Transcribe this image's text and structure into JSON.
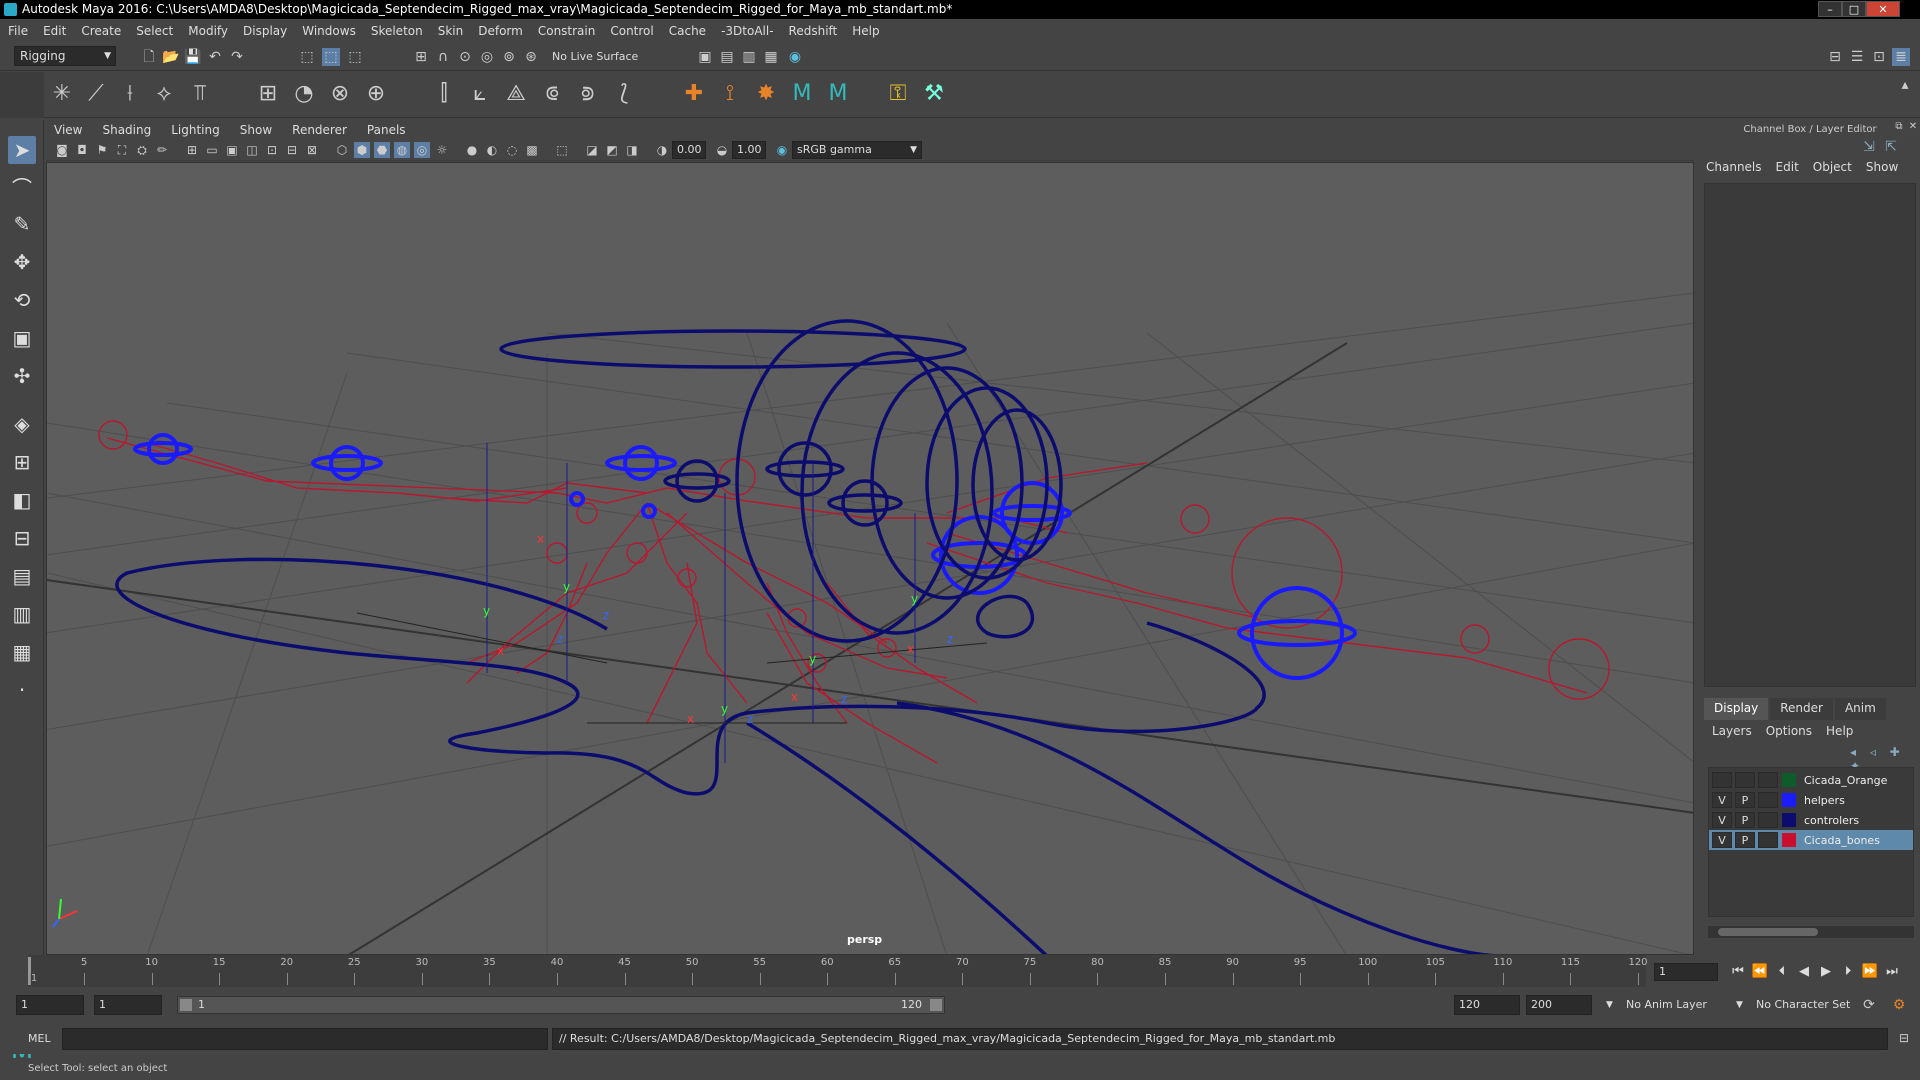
{
  "window": {
    "title": "Autodesk Maya 2016: C:\\Users\\AMDA8\\Desktop\\Magicicada_Septendecim_Rigged_max_vray\\Magicicada_Septendecim_Rigged_for_Maya_mb_standart.mb*",
    "controls": {
      "minimize": "–",
      "maximize": "□",
      "close": "✕"
    }
  },
  "menubar": {
    "items": [
      "File",
      "Edit",
      "Create",
      "Select",
      "Modify",
      "Display",
      "Windows",
      "Skeleton",
      "Skin",
      "Deform",
      "Constrain",
      "Control",
      "Cache",
      "-3DtoAll-",
      "Redshift",
      "Help"
    ]
  },
  "statusline": {
    "mode": "Rigging",
    "live_surface": "No Live Surface"
  },
  "viewport": {
    "menus": [
      "View",
      "Shading",
      "Lighting",
      "Show",
      "Renderer",
      "Panels"
    ],
    "exposure": "0.00",
    "gamma": "1.00",
    "color_space": "sRGB gamma",
    "camera_label": "persp",
    "axis_colors": {
      "x": "#ff3333",
      "y": "#33ff33",
      "z": "#3366ff"
    }
  },
  "channel_box": {
    "title": "Channel Box / Layer Editor",
    "menus": [
      "Channels",
      "Edit",
      "Object",
      "Show"
    ]
  },
  "layer_editor": {
    "tabs": [
      "Display",
      "Render",
      "Anim"
    ],
    "active_tab": "Display",
    "menus": [
      "Layers",
      "Options",
      "Help"
    ],
    "layers": [
      {
        "v": "",
        "p": "",
        "color": "#0e5c2a",
        "name": "Cicada_Orange"
      },
      {
        "v": "V",
        "p": "P",
        "color": "#1c1cff",
        "name": "helpers"
      },
      {
        "v": "V",
        "p": "P",
        "color": "#0c0c6e",
        "name": "controlers"
      },
      {
        "v": "V",
        "p": "P",
        "color": "#c8102e",
        "name": "Cicada_bones"
      }
    ]
  },
  "timeline": {
    "ticks": [
      "1",
      "5",
      "10",
      "15",
      "20",
      "25",
      "30",
      "35",
      "40",
      "45",
      "50",
      "55",
      "60",
      "65",
      "70",
      "75",
      "80",
      "85",
      "90",
      "95",
      "100",
      "105",
      "110",
      "115",
      "120"
    ],
    "current_frame": "1"
  },
  "range": {
    "start": "1",
    "playback_start": "1",
    "slider_start": "1",
    "slider_end": "120",
    "playback_end": "120",
    "end": "200",
    "anim_layer": "No Anim Layer",
    "character_set": "No Character Set"
  },
  "command": {
    "label": "MEL",
    "result": "// Result: C:/Users/AMDA8/Desktop/Magicicada_Septendecim_Rigged_max_vray/Magicicada_Septendecim_Rigged_for_Maya_mb_standart.mb"
  },
  "help_line": "Select Tool: select an object"
}
